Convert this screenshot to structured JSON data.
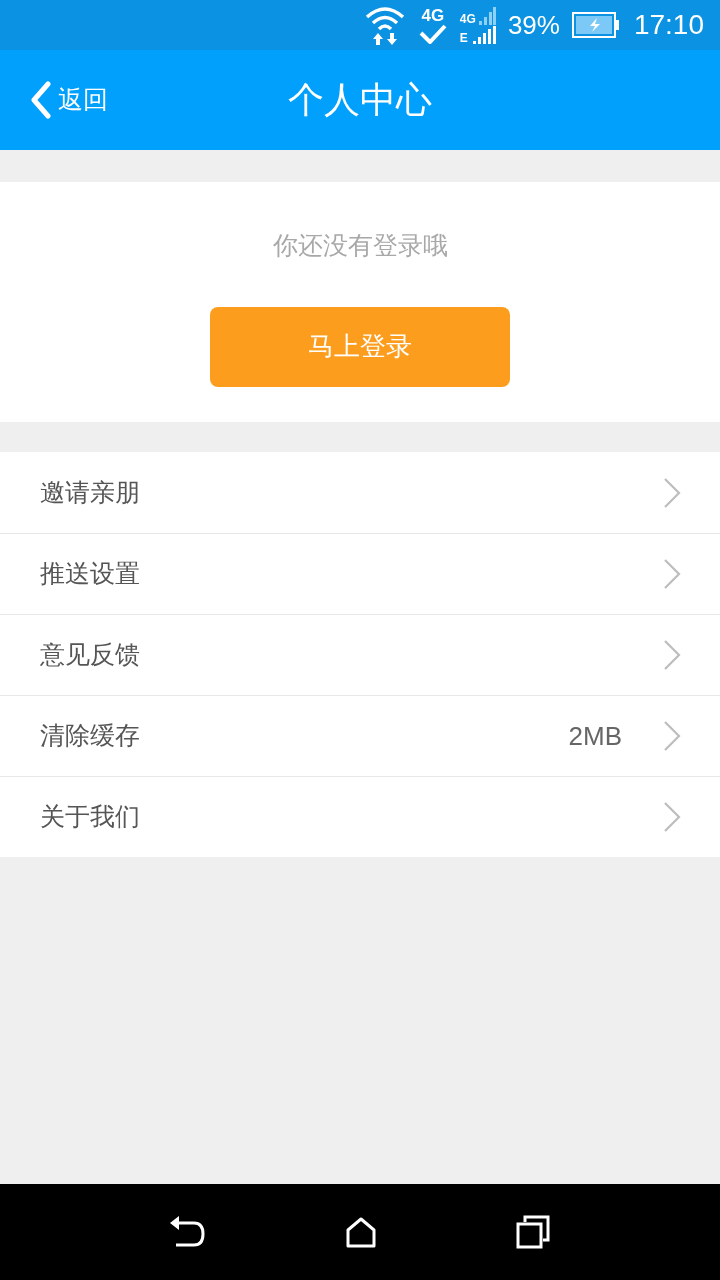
{
  "status_bar": {
    "network_labels": [
      "4G",
      "4G",
      "E"
    ],
    "battery": "39%",
    "time": "17:10"
  },
  "header": {
    "back": "返回",
    "title": "个人中心"
  },
  "login": {
    "message": "你还没有登录哦",
    "button": "马上登录"
  },
  "menu": [
    {
      "label": "邀请亲朋"
    },
    {
      "label": "推送设置"
    },
    {
      "label": "意见反馈"
    },
    {
      "label": "清除缓存",
      "value": "2MB"
    },
    {
      "label": "关于我们"
    }
  ]
}
